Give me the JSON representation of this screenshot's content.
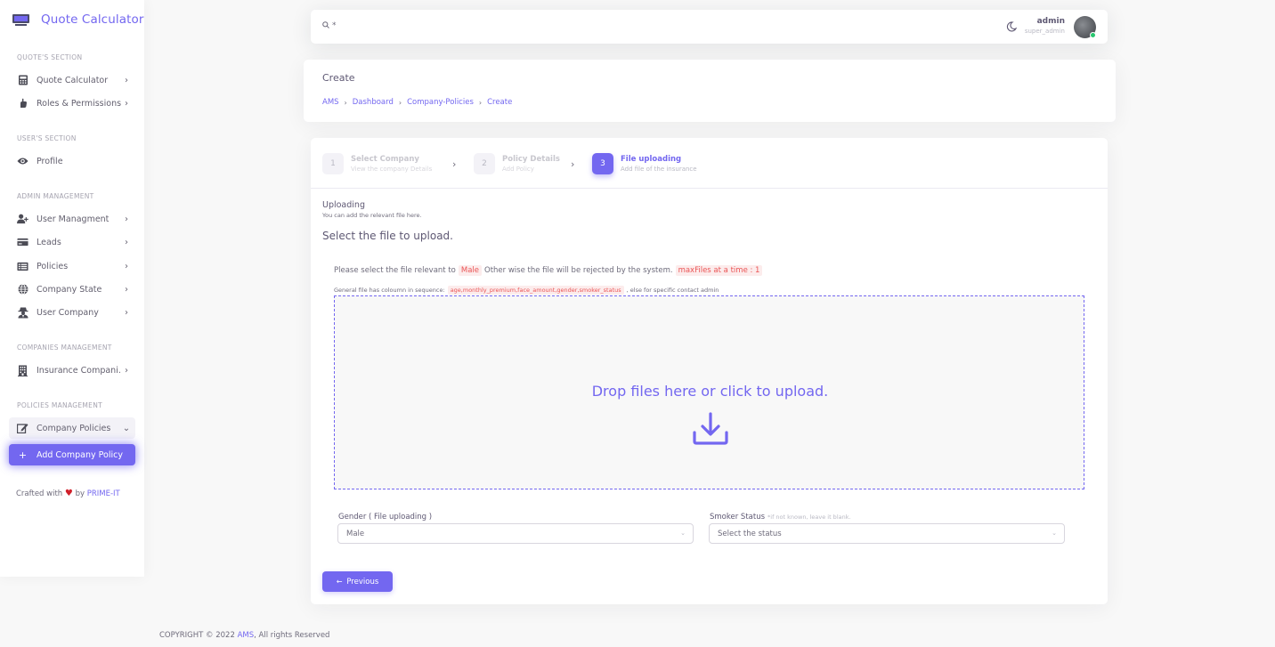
{
  "brand": {
    "name": "Quote Calculator"
  },
  "sidebar": {
    "sections": [
      {
        "header": "QUOTE'S SECTION"
      },
      {
        "header": "USER'S SECTION"
      },
      {
        "header": "ADMIN MANAGEMENT"
      },
      {
        "header": "COMPANIES MANAGEMENT"
      },
      {
        "header": "POLICIES MANAGEMENT"
      }
    ],
    "items": [
      {
        "label": "Quote Calculator",
        "icon": "calculator-icon",
        "chevron": "›"
      },
      {
        "label": "Roles & Permissions",
        "icon": "hand-icon",
        "chevron": "›"
      },
      {
        "label": "Profile",
        "icon": "eye-icon"
      },
      {
        "label": "User Managment",
        "icon": "user-plus-icon",
        "chevron": "›"
      },
      {
        "label": "Leads",
        "icon": "credit-card-icon",
        "chevron": "›"
      },
      {
        "label": "Policies",
        "icon": "list-icon",
        "chevron": "›"
      },
      {
        "label": "Company State",
        "icon": "globe-icon",
        "chevron": "›"
      },
      {
        "label": "User Company",
        "icon": "user-secret-icon",
        "chevron": "›"
      },
      {
        "label": "Insurance Compani...",
        "icon": "building-icon",
        "chevron": "›"
      },
      {
        "label": "Company Policies",
        "icon": "edit-icon",
        "chevron": "⌄"
      },
      {
        "label": "Add Company Policy",
        "icon": "plus-icon",
        "plus": "+"
      }
    ],
    "crafted": {
      "prefix": "Crafted with",
      "by": "by",
      "link": "PRIME-IT"
    }
  },
  "topbar": {
    "search_text": "*",
    "user_name": "admin",
    "user_role": "super_admin"
  },
  "breadcrumb_card": {
    "title": "Create",
    "crumbs": [
      "AMS",
      "Dashboard",
      "Company-Policies",
      "Create"
    ]
  },
  "stepper": {
    "steps": [
      {
        "num": "1",
        "title": "Select Company",
        "subtitle": "View the company Details"
      },
      {
        "num": "2",
        "title": "Policy Details",
        "subtitle": "Add Policy"
      },
      {
        "num": "3",
        "title": "File uploading",
        "subtitle": "Add file of the insurance"
      }
    ],
    "active_step": 3
  },
  "upload": {
    "heading": "Uploading",
    "subheading": "You can add the relevant file here.",
    "select_title": "Select the file to upload.",
    "note1_prefix": "Please select the file relevant to",
    "note1_tag": "Male",
    "note1_middle": "Other wise the file will be rejected by the system.",
    "note1_tag2": "maxFiles at a time : 1",
    "note2_prefix": "General file has coloumn in sequence:",
    "note2_tag": "age,monthly_premium,face_amount,gender,smoker_status",
    "note2_suffix": ", else for specific contact admin",
    "dropzone_text": "Drop files here or click to upload."
  },
  "form": {
    "gender_label": "Gender ( File uploading )",
    "gender_value": "Male",
    "smoker_label": "Smoker Status",
    "smoker_hint": "*if not known, leave it blank.",
    "smoker_placeholder": "Select the status",
    "previous_button": "Previous"
  },
  "footer": {
    "prefix": "COPYRIGHT © 2022",
    "link": "AMS",
    "suffix": ", All rights Reserved"
  },
  "colors": {
    "primary": "#7367f0",
    "danger": "#ea5455",
    "success": "#28c76f"
  }
}
